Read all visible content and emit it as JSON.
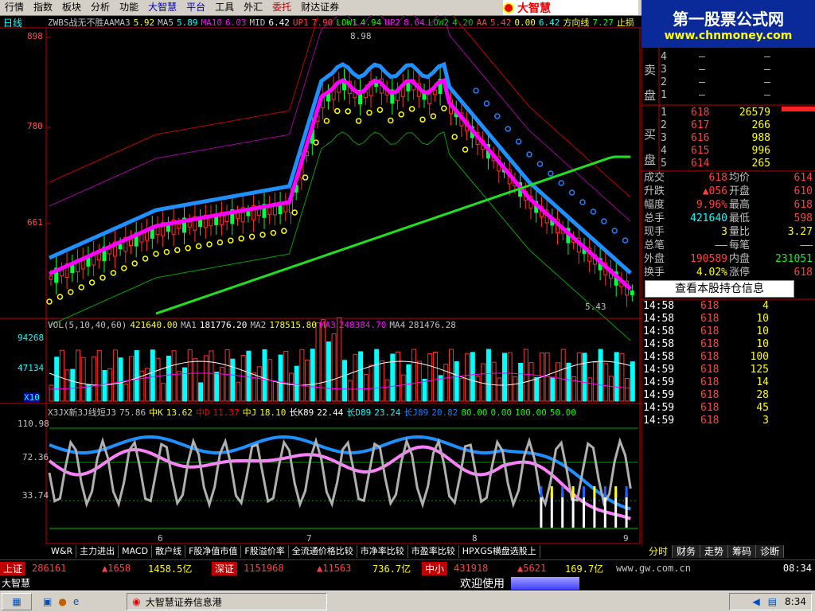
{
  "menu": [
    {
      "label": "行情",
      "style": ""
    },
    {
      "label": "指数",
      "style": ""
    },
    {
      "label": "板块",
      "style": ""
    },
    {
      "label": "分析",
      "style": ""
    },
    {
      "label": "功能",
      "style": ""
    },
    {
      "label": "大智慧",
      "style": "hl"
    },
    {
      "label": "平台",
      "style": "hl"
    },
    {
      "label": "工具",
      "style": ""
    },
    {
      "label": "外汇",
      "style": ""
    },
    {
      "label": "委托",
      "style": "red"
    },
    {
      "label": "财达证券",
      "style": ""
    }
  ],
  "logo": "大智慧",
  "watermark": {
    "line1": "第一股票公式网",
    "line2": "www.chnmoney.com"
  },
  "chart": {
    "period": "日线",
    "indicator_line": [
      {
        "t": "ZWBS战无不胜AAMA3",
        "c": "#c0c0c0"
      },
      {
        "t": "5.92",
        "c": "#ffff00"
      },
      {
        "t": "MA5",
        "c": "#c0c0c0"
      },
      {
        "t": "5.89",
        "c": "#00ffff"
      },
      {
        "t": "MA10",
        "c": "#ff00ff"
      },
      {
        "t": "6.03",
        "c": "#ff00ff"
      },
      {
        "t": "MID",
        "c": "#c0c0c0"
      },
      {
        "t": "6.42",
        "c": "#ffffff"
      },
      {
        "t": "UP1",
        "c": "#ff4040"
      },
      {
        "t": "7.90",
        "c": "#ff4040"
      },
      {
        "t": "LOW1",
        "c": "#00ff00"
      },
      {
        "t": "4.94",
        "c": "#00ff00"
      },
      {
        "t": "UP2",
        "c": "#ff00ff"
      },
      {
        "t": "8.64",
        "c": "#ff00ff"
      },
      {
        "t": "LOW2",
        "c": "#00c000"
      },
      {
        "t": "4.20",
        "c": "#00c000"
      },
      {
        "t": "AA",
        "c": "#ff4040"
      },
      {
        "t": "5.42",
        "c": "#ff4040"
      },
      {
        "t": "0.00",
        "c": "#ffff00"
      },
      {
        "t": "6.42",
        "c": "#00ffff"
      },
      {
        "t": "方向线",
        "c": "#ffff00"
      },
      {
        "t": "7.27",
        "c": "#00ff00"
      },
      {
        "t": "止损",
        "c": "#ffff00"
      }
    ],
    "price_ticks": [
      "898",
      "780",
      "661"
    ],
    "high_label": "8.98",
    "low_label": "5.43",
    "vol_line": [
      {
        "t": "VOL(5,10,40,60)",
        "c": "#c0c0c0"
      },
      {
        "t": "421640.00",
        "c": "#ffff00"
      },
      {
        "t": "MA1",
        "c": "#c0c0c0"
      },
      {
        "t": "181776.20",
        "c": "#ffffff"
      },
      {
        "t": "MA2",
        "c": "#c0c0c0"
      },
      {
        "t": "178515.80",
        "c": "#ffff00"
      },
      {
        "t": "MA3",
        "c": "#ff00ff"
      },
      {
        "t": "248384.70",
        "c": "#ff00ff"
      },
      {
        "t": "MA4",
        "c": "#c0c0c0"
      },
      {
        "t": "281476.28",
        "c": "#c0c0c0"
      }
    ],
    "vol_ticks": [
      "94268",
      "47134",
      "X10"
    ],
    "kdj_line": [
      {
        "t": "X3JX新3J线短J3",
        "c": "#c0c0c0"
      },
      {
        "t": "75.86",
        "c": "#c0c0c0"
      },
      {
        "t": "中K",
        "c": "#ffff00"
      },
      {
        "t": "13.62",
        "c": "#ffff00"
      },
      {
        "t": "中D",
        "c": "#ff0000"
      },
      {
        "t": "11.37",
        "c": "#ff0000"
      },
      {
        "t": "中J",
        "c": "#ffff00"
      },
      {
        "t": "18.10",
        "c": "#ffff00"
      },
      {
        "t": "长K89",
        "c": "#ffffff"
      },
      {
        "t": "22.44",
        "c": "#ffffff"
      },
      {
        "t": "长D89",
        "c": "#00ffff"
      },
      {
        "t": "23.24",
        "c": "#00ffff"
      },
      {
        "t": "长J89",
        "c": "#0080ff"
      },
      {
        "t": "20.82",
        "c": "#0080ff"
      },
      {
        "t": "80.00",
        "c": "#00ff00"
      },
      {
        "t": "0.00",
        "c": "#00ff00"
      },
      {
        "t": "100.00",
        "c": "#00ff00"
      },
      {
        "t": "50.00",
        "c": "#00ff00"
      }
    ],
    "kdj_ticks": [
      "110.98",
      "72.36",
      "33.74"
    ],
    "months": [
      "6",
      "7",
      "8",
      "9"
    ]
  },
  "book": {
    "sell_label": [
      "卖",
      "盘"
    ],
    "buy_label": [
      "买",
      "盘"
    ],
    "sell": [
      {
        "n": "4",
        "p": "—",
        "v": "—"
      },
      {
        "n": "3",
        "p": "—",
        "v": "—"
      },
      {
        "n": "2",
        "p": "—",
        "v": "—"
      },
      {
        "n": "1",
        "p": "—",
        "v": "—"
      }
    ],
    "buy": [
      {
        "n": "1",
        "p": "618",
        "v": "26579"
      },
      {
        "n": "2",
        "p": "617",
        "v": "266"
      },
      {
        "n": "3",
        "p": "616",
        "v": "988"
      },
      {
        "n": "4",
        "p": "615",
        "v": "996"
      },
      {
        "n": "5",
        "p": "614",
        "v": "265"
      }
    ]
  },
  "stats": [
    {
      "k1": "成交",
      "v1": "618",
      "c1": "#ff4040",
      "k2": "均价",
      "v2": "614",
      "c2": "#ff4040"
    },
    {
      "k1": "升跌",
      "v1": "▲056",
      "c1": "#ff4040",
      "k2": "开盘",
      "v2": "610",
      "c2": "#ff4040"
    },
    {
      "k1": "幅度",
      "v1": "9.96%",
      "c1": "#ff4040",
      "k2": "最高",
      "v2": "618",
      "c2": "#ff4040"
    },
    {
      "k1": "总手",
      "v1": "421640",
      "c1": "#00ffff",
      "k2": "最低",
      "v2": "598",
      "c2": "#ff4040"
    },
    {
      "k1": "现手",
      "v1": "3",
      "c1": "#ffff00",
      "k2": "量比",
      "v2": "3.27",
      "c2": "#ffff00"
    },
    {
      "k1": "总笔",
      "v1": "——",
      "c1": "#c0c0c0",
      "k2": "每笔",
      "v2": "——",
      "c2": "#c0c0c0"
    },
    {
      "k1": "外盘",
      "v1": "190589",
      "c1": "#ff4040",
      "k2": "内盘",
      "v2": "231051",
      "c2": "#00ff00"
    },
    {
      "k1": "换手",
      "v1": "4.02%",
      "c1": "#ffff00",
      "k2": "涨停",
      "v2": "618",
      "c2": "#ff4040"
    }
  ],
  "holdings_button": "查看本股持仓信息",
  "ticks": [
    {
      "t": "14:58",
      "p": "618",
      "v": "4"
    },
    {
      "t": "14:58",
      "p": "618",
      "v": "10"
    },
    {
      "t": "14:58",
      "p": "618",
      "v": "10"
    },
    {
      "t": "14:58",
      "p": "618",
      "v": "10"
    },
    {
      "t": "14:58",
      "p": "618",
      "v": "100"
    },
    {
      "t": "14:59",
      "p": "618",
      "v": "125"
    },
    {
      "t": "14:59",
      "p": "618",
      "v": "14"
    },
    {
      "t": "14:59",
      "p": "618",
      "v": "28"
    },
    {
      "t": "14:59",
      "p": "618",
      "v": "45"
    },
    {
      "t": "14:59",
      "p": "618",
      "v": "3"
    }
  ],
  "bottom_tabs": [
    "W&R",
    "主力进出",
    "MACD",
    "散户线",
    "F股净值市值",
    "F股溢价率",
    "全流通价格比较",
    "市净率比较",
    "市盈率比较",
    "HPXGS横盘选股上"
  ],
  "right_tabs": [
    "分时",
    "财务",
    "走势",
    "筹码",
    "诊断"
  ],
  "status": {
    "sh_label": "上证",
    "sh_vol": "286161",
    "sh_chg": "▲1658",
    "sh_amt": "1458.5亿",
    "sz_label": "深证",
    "sz_vol": "1151968",
    "sz_chg": "▲11563",
    "sz_amt": "736.7亿",
    "zx_label": "中小",
    "zx_vol": "431918",
    "zx_chg": "▲5621",
    "zx_amt": "169.7亿",
    "url": "www.gw.com.cn",
    "time": "08:34"
  },
  "msg": {
    "brand": "大智慧",
    "welcome": "欢迎使用"
  },
  "taskbar": {
    "window": "大智慧证券信息港",
    "clock": "8:34"
  }
}
